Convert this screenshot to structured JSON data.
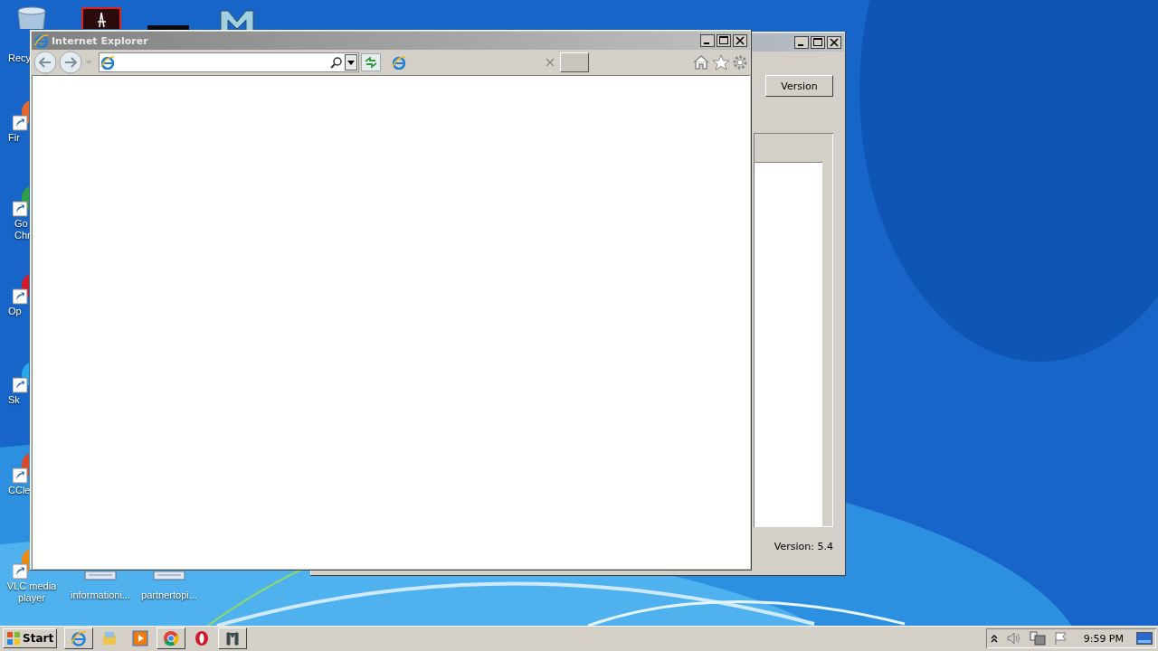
{
  "desktop_icons": [
    {
      "label": "Recy",
      "kind": "recycle"
    },
    {
      "label": "Fir",
      "kind": "firefox"
    },
    {
      "label": "Go Chr",
      "kind": "chrome"
    },
    {
      "label": "Op",
      "kind": "opera"
    },
    {
      "label": "Sk",
      "kind": "skype"
    },
    {
      "label": "CCle",
      "kind": "ccleaner"
    },
    {
      "label": "VLC media player",
      "kind": "vlc"
    },
    {
      "label": "informationi...",
      "kind": "file"
    },
    {
      "label": "partnertopi...",
      "kind": "file"
    }
  ],
  "back_window": {
    "button": "Version",
    "version_label": "Version: 5.4"
  },
  "browser": {
    "title": "Internet Explorer"
  },
  "taskbar": {
    "start": "Start",
    "clock": "9:59 PM"
  }
}
